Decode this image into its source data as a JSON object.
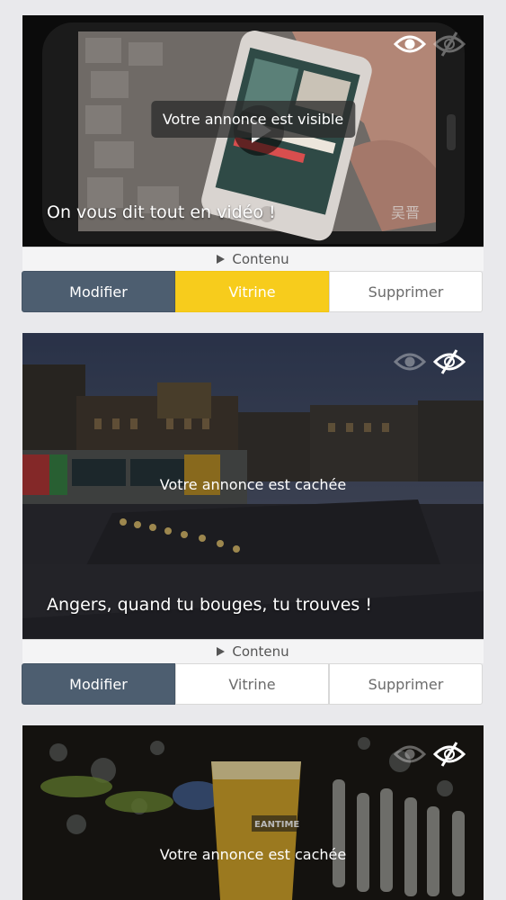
{
  "listings": [
    {
      "status_text": "Votre annonce est visible",
      "title": "On vous dit tout en vidéo !",
      "visibility": "visible",
      "content_label": "Contenu",
      "actions": {
        "modify": "Modifier",
        "vitrine": "Vitrine",
        "delete": "Supprimer"
      },
      "vitrine_active": true
    },
    {
      "status_text": "Votre annonce est cachée",
      "title": "Angers, quand tu bouges, tu trouves !",
      "visibility": "hidden",
      "content_label": "Contenu",
      "actions": {
        "modify": "Modifier",
        "vitrine": "Vitrine",
        "delete": "Supprimer"
      },
      "vitrine_active": false
    },
    {
      "status_text": "Votre annonce est cachée",
      "visibility": "hidden"
    }
  ],
  "icons": {
    "visible": "eye-icon",
    "hidden": "eye-slash-icon",
    "play": "play-icon",
    "expand": "triangle-right-icon"
  },
  "colors": {
    "modify_button": "#4d5e70",
    "vitrine_active": "#f7cc1c",
    "page_background": "#e9e9ec"
  }
}
